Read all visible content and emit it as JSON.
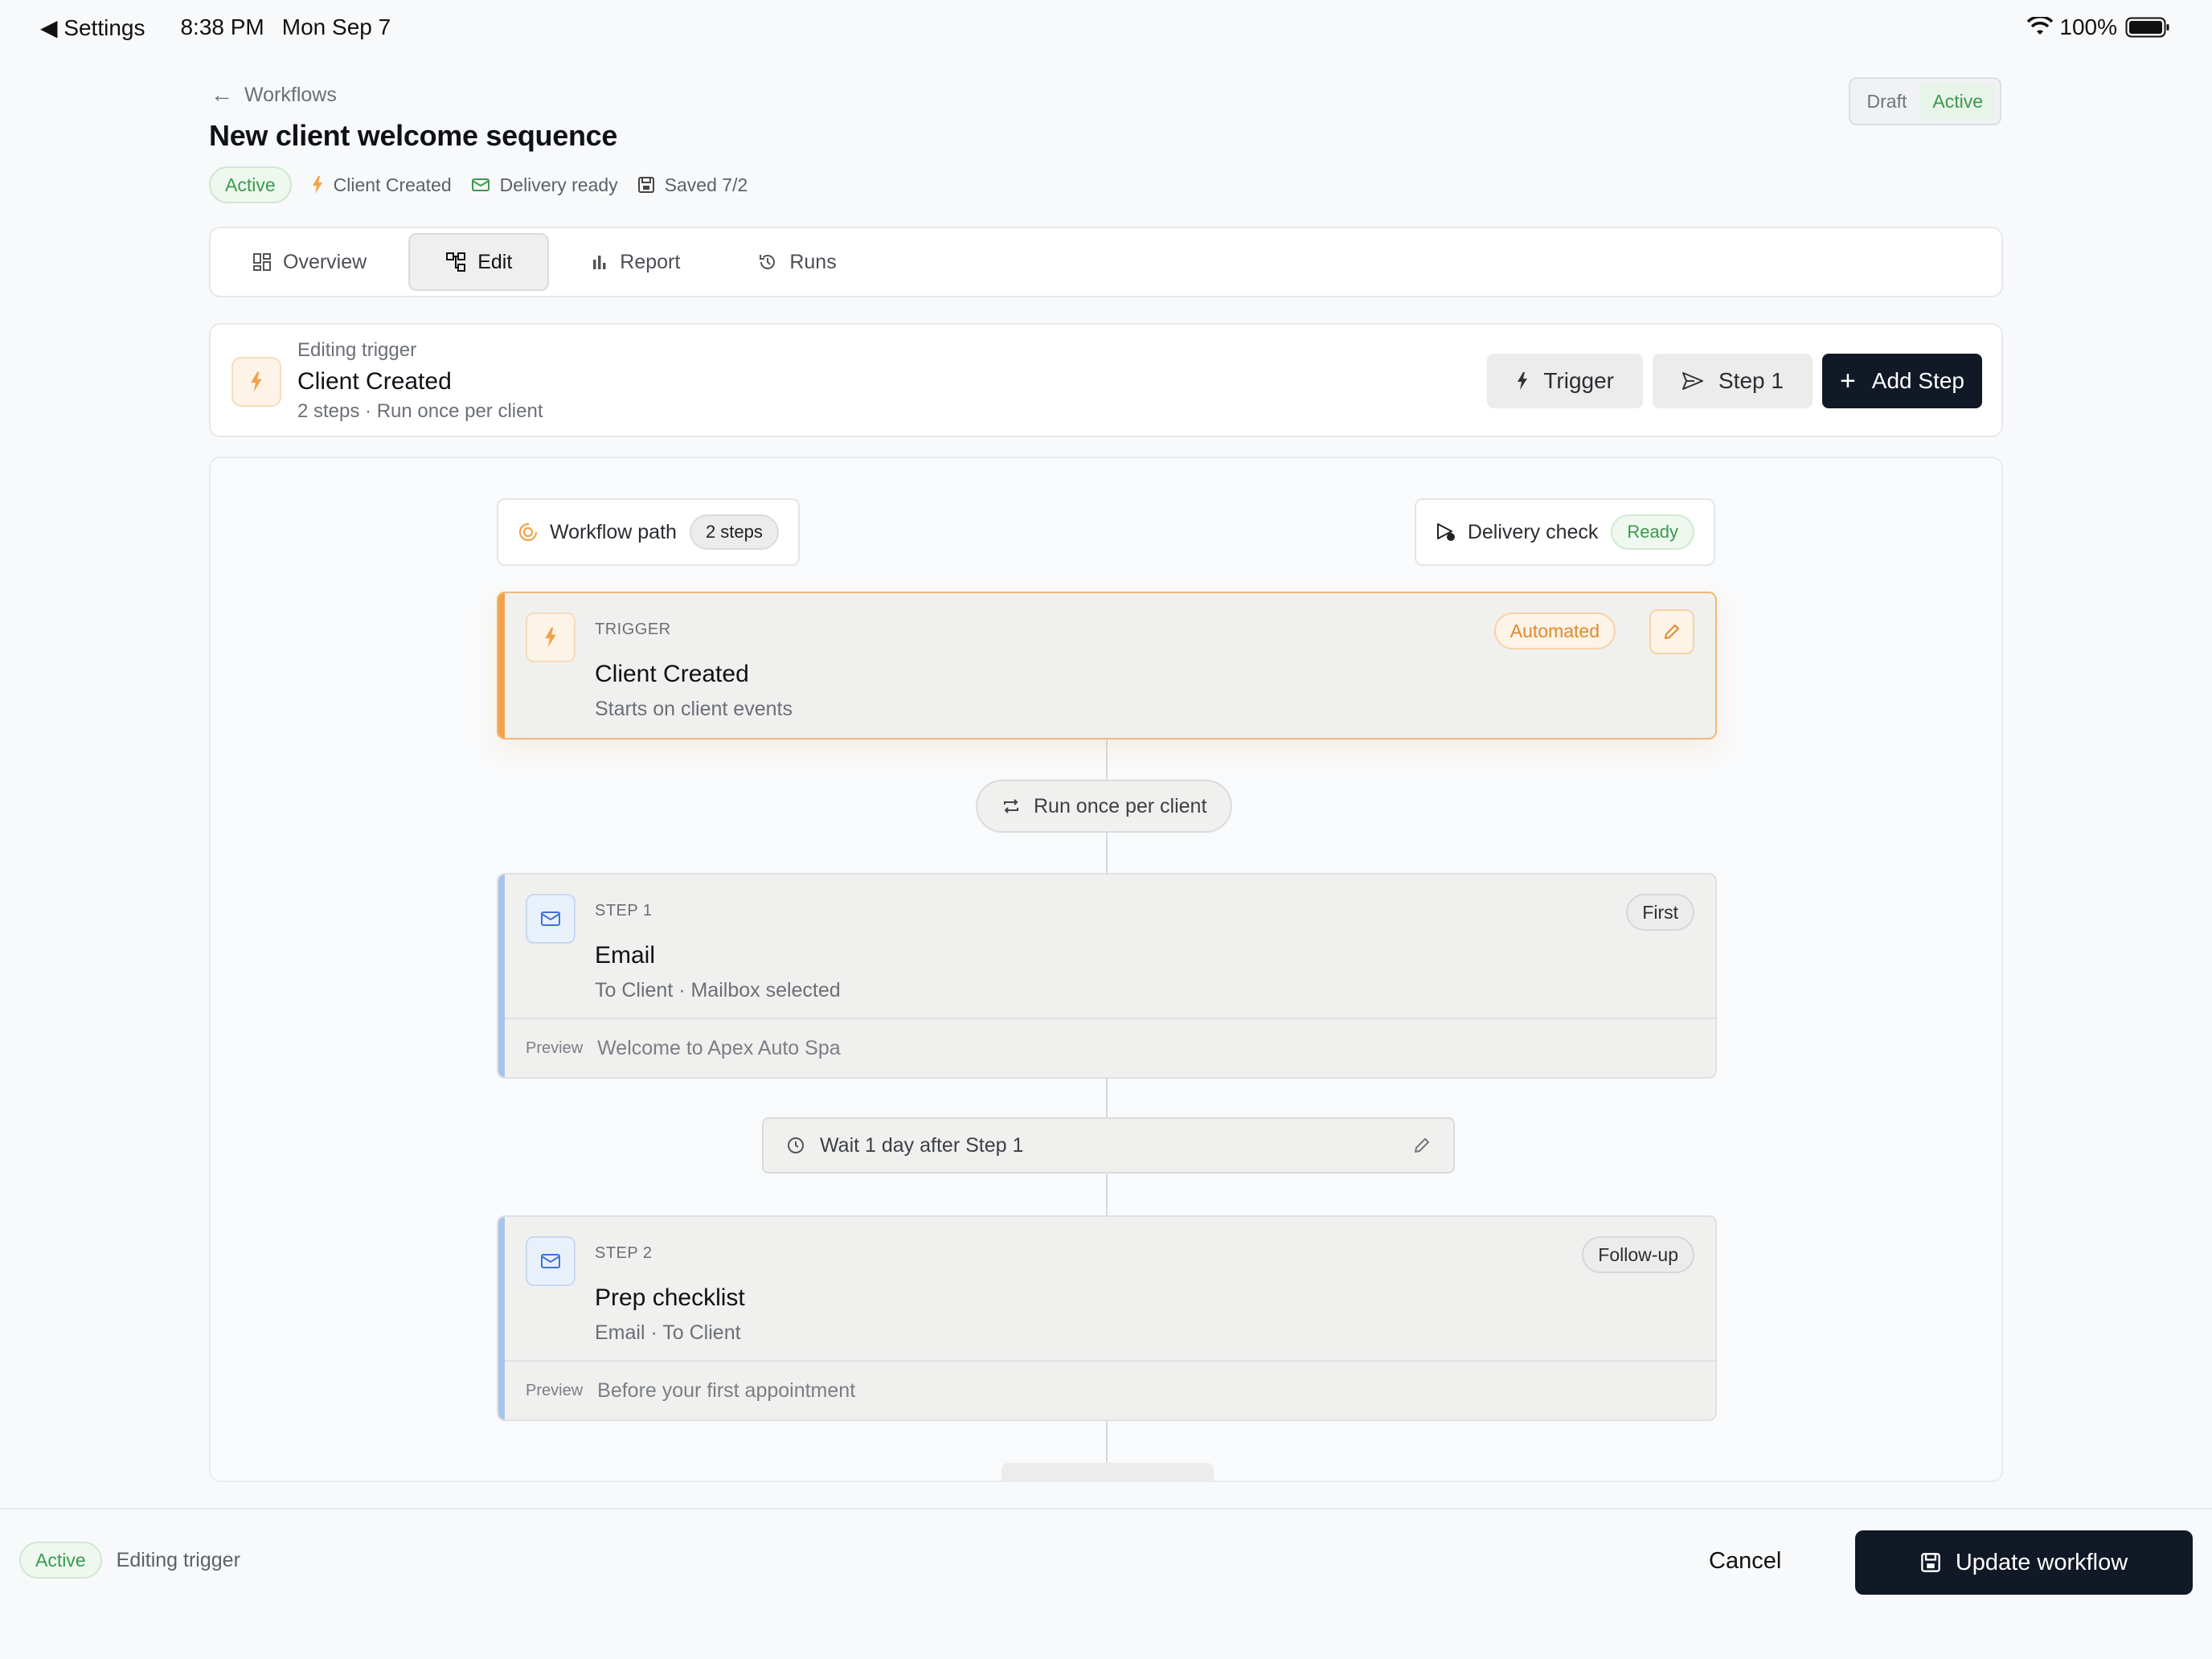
{
  "status_bar": {
    "back_label": "Settings",
    "time": "8:38 PM",
    "date": "Mon Sep 7",
    "battery": "100%"
  },
  "header": {
    "back_link": "Workflows",
    "title": "New client welcome sequence",
    "status": "Active",
    "meta": [
      "Client Created",
      "Delivery ready",
      "Saved 7/2"
    ],
    "toggle": {
      "options": [
        "Draft",
        "Active"
      ],
      "selected": "Active"
    }
  },
  "tabs": [
    {
      "label": "Overview",
      "icon": "grid-icon"
    },
    {
      "label": "Edit",
      "icon": "workflow-icon"
    },
    {
      "label": "Report",
      "icon": "bar-chart-icon"
    },
    {
      "label": "Runs",
      "icon": "history-icon"
    }
  ],
  "active_tab": "Edit",
  "editing_bar": {
    "kicker": "Editing trigger",
    "title": "Client Created",
    "subtitle": "2 steps · Run once per client",
    "buttons": {
      "trigger": "Trigger",
      "step1": "Step 1",
      "add_step": "Add Step"
    }
  },
  "canvas": {
    "workflow_path": {
      "label": "Workflow path",
      "count": "2 steps"
    },
    "delivery_check": {
      "label": "Delivery check",
      "status": "Ready"
    },
    "trigger_card": {
      "kicker": "TRIGGER",
      "title": "Client Created",
      "subtitle": "Starts on client events",
      "badge": "Automated"
    },
    "run_rule": "Run once per client",
    "step1": {
      "kicker": "STEP 1",
      "title": "Email",
      "subtitle": "To Client · Mailbox selected",
      "badge": "First",
      "preview_label": "Preview",
      "preview_text": "Welcome to Apex Auto Spa"
    },
    "wait": "Wait 1 day after Step 1",
    "step2": {
      "kicker": "STEP 2",
      "title": "Prep checklist",
      "subtitle": "Email · To Client",
      "badge": "Follow-up",
      "preview_label": "Preview",
      "preview_text": "Before your first appointment"
    }
  },
  "footer": {
    "status": "Active",
    "mode": "Editing trigger",
    "cancel": "Cancel",
    "update": "Update workflow"
  },
  "colors": {
    "accent_dark": "#111826",
    "active_green": "#3a9a4c",
    "trigger_orange": "#f2a24a",
    "step_blue": "#3c74d6"
  }
}
